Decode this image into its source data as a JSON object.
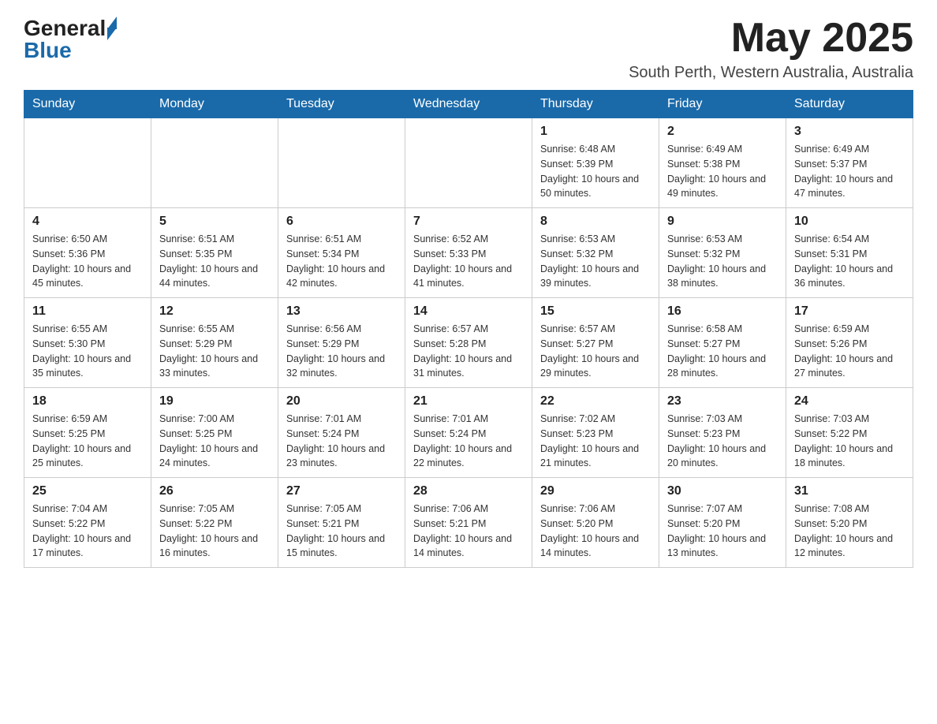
{
  "header": {
    "logo_general": "General",
    "logo_blue": "Blue",
    "month_year": "May 2025",
    "location": "South Perth, Western Australia, Australia"
  },
  "calendar": {
    "days_of_week": [
      "Sunday",
      "Monday",
      "Tuesday",
      "Wednesday",
      "Thursday",
      "Friday",
      "Saturday"
    ],
    "weeks": [
      [
        {
          "day": "",
          "info": ""
        },
        {
          "day": "",
          "info": ""
        },
        {
          "day": "",
          "info": ""
        },
        {
          "day": "",
          "info": ""
        },
        {
          "day": "1",
          "info": "Sunrise: 6:48 AM\nSunset: 5:39 PM\nDaylight: 10 hours and 50 minutes."
        },
        {
          "day": "2",
          "info": "Sunrise: 6:49 AM\nSunset: 5:38 PM\nDaylight: 10 hours and 49 minutes."
        },
        {
          "day": "3",
          "info": "Sunrise: 6:49 AM\nSunset: 5:37 PM\nDaylight: 10 hours and 47 minutes."
        }
      ],
      [
        {
          "day": "4",
          "info": "Sunrise: 6:50 AM\nSunset: 5:36 PM\nDaylight: 10 hours and 45 minutes."
        },
        {
          "day": "5",
          "info": "Sunrise: 6:51 AM\nSunset: 5:35 PM\nDaylight: 10 hours and 44 minutes."
        },
        {
          "day": "6",
          "info": "Sunrise: 6:51 AM\nSunset: 5:34 PM\nDaylight: 10 hours and 42 minutes."
        },
        {
          "day": "7",
          "info": "Sunrise: 6:52 AM\nSunset: 5:33 PM\nDaylight: 10 hours and 41 minutes."
        },
        {
          "day": "8",
          "info": "Sunrise: 6:53 AM\nSunset: 5:32 PM\nDaylight: 10 hours and 39 minutes."
        },
        {
          "day": "9",
          "info": "Sunrise: 6:53 AM\nSunset: 5:32 PM\nDaylight: 10 hours and 38 minutes."
        },
        {
          "day": "10",
          "info": "Sunrise: 6:54 AM\nSunset: 5:31 PM\nDaylight: 10 hours and 36 minutes."
        }
      ],
      [
        {
          "day": "11",
          "info": "Sunrise: 6:55 AM\nSunset: 5:30 PM\nDaylight: 10 hours and 35 minutes."
        },
        {
          "day": "12",
          "info": "Sunrise: 6:55 AM\nSunset: 5:29 PM\nDaylight: 10 hours and 33 minutes."
        },
        {
          "day": "13",
          "info": "Sunrise: 6:56 AM\nSunset: 5:29 PM\nDaylight: 10 hours and 32 minutes."
        },
        {
          "day": "14",
          "info": "Sunrise: 6:57 AM\nSunset: 5:28 PM\nDaylight: 10 hours and 31 minutes."
        },
        {
          "day": "15",
          "info": "Sunrise: 6:57 AM\nSunset: 5:27 PM\nDaylight: 10 hours and 29 minutes."
        },
        {
          "day": "16",
          "info": "Sunrise: 6:58 AM\nSunset: 5:27 PM\nDaylight: 10 hours and 28 minutes."
        },
        {
          "day": "17",
          "info": "Sunrise: 6:59 AM\nSunset: 5:26 PM\nDaylight: 10 hours and 27 minutes."
        }
      ],
      [
        {
          "day": "18",
          "info": "Sunrise: 6:59 AM\nSunset: 5:25 PM\nDaylight: 10 hours and 25 minutes."
        },
        {
          "day": "19",
          "info": "Sunrise: 7:00 AM\nSunset: 5:25 PM\nDaylight: 10 hours and 24 minutes."
        },
        {
          "day": "20",
          "info": "Sunrise: 7:01 AM\nSunset: 5:24 PM\nDaylight: 10 hours and 23 minutes."
        },
        {
          "day": "21",
          "info": "Sunrise: 7:01 AM\nSunset: 5:24 PM\nDaylight: 10 hours and 22 minutes."
        },
        {
          "day": "22",
          "info": "Sunrise: 7:02 AM\nSunset: 5:23 PM\nDaylight: 10 hours and 21 minutes."
        },
        {
          "day": "23",
          "info": "Sunrise: 7:03 AM\nSunset: 5:23 PM\nDaylight: 10 hours and 20 minutes."
        },
        {
          "day": "24",
          "info": "Sunrise: 7:03 AM\nSunset: 5:22 PM\nDaylight: 10 hours and 18 minutes."
        }
      ],
      [
        {
          "day": "25",
          "info": "Sunrise: 7:04 AM\nSunset: 5:22 PM\nDaylight: 10 hours and 17 minutes."
        },
        {
          "day": "26",
          "info": "Sunrise: 7:05 AM\nSunset: 5:22 PM\nDaylight: 10 hours and 16 minutes."
        },
        {
          "day": "27",
          "info": "Sunrise: 7:05 AM\nSunset: 5:21 PM\nDaylight: 10 hours and 15 minutes."
        },
        {
          "day": "28",
          "info": "Sunrise: 7:06 AM\nSunset: 5:21 PM\nDaylight: 10 hours and 14 minutes."
        },
        {
          "day": "29",
          "info": "Sunrise: 7:06 AM\nSunset: 5:20 PM\nDaylight: 10 hours and 14 minutes."
        },
        {
          "day": "30",
          "info": "Sunrise: 7:07 AM\nSunset: 5:20 PM\nDaylight: 10 hours and 13 minutes."
        },
        {
          "day": "31",
          "info": "Sunrise: 7:08 AM\nSunset: 5:20 PM\nDaylight: 10 hours and 12 minutes."
        }
      ]
    ]
  }
}
